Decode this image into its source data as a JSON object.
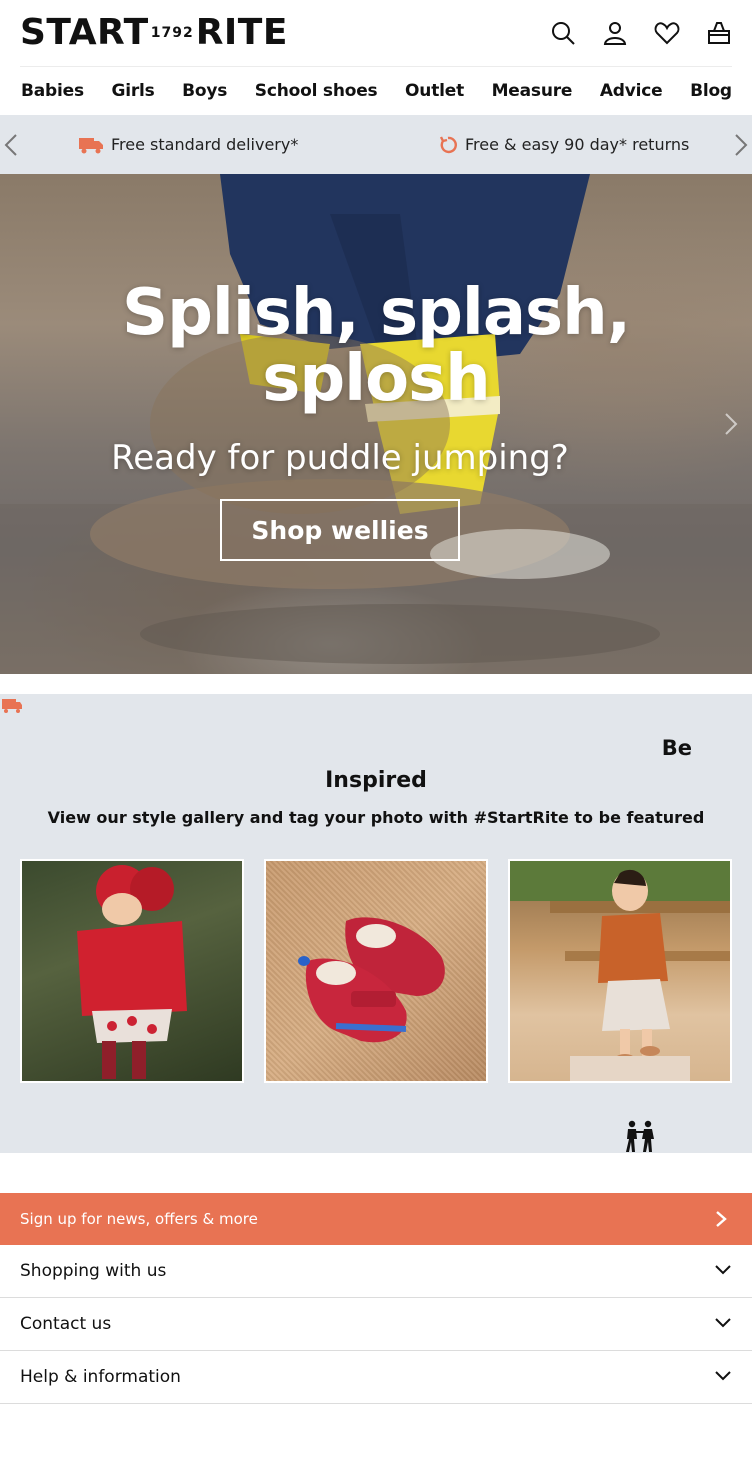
{
  "header": {
    "logo_left": "START",
    "logo_year": "1792",
    "logo_right": "RITE",
    "icons": [
      "search-icon",
      "account-icon",
      "wishlist-heart-icon",
      "basket-icon"
    ]
  },
  "nav": {
    "items": [
      "Babies",
      "Girls",
      "Boys",
      "School shoes",
      "Outlet",
      "Measure",
      "Advice",
      "Blog"
    ]
  },
  "promo": {
    "delivery": "Free standard delivery*",
    "returns": "Free & easy 90 day* returns",
    "accent": "#e87353"
  },
  "hero": {
    "title_line1": "Splish, splash,",
    "title_line2": "splosh",
    "subtitle": "Ready for puddle jumping?",
    "button": "Shop wellies"
  },
  "inspired": {
    "be": "Be",
    "title": "Inspired",
    "subtitle": "View our style gallery and tag your photo with #StartRite to be featured"
  },
  "footer": {
    "signup": "Sign up for news, offers & more",
    "accordion": [
      "Shopping with us",
      "Contact us",
      "Help & information"
    ]
  },
  "colors": {
    "promo_bg": "#e2e6eb",
    "signup_bg": "#e87353"
  }
}
